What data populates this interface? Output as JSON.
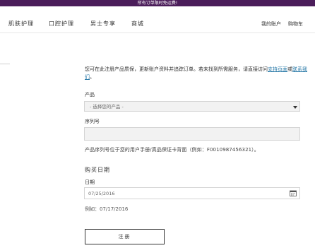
{
  "promo_banner": {
    "text": "所有订单限时免运费!"
  },
  "nav": {
    "items": [
      "肌肤护理",
      "口腔护理",
      "男士专享",
      "商城"
    ],
    "my_account": "我的账户",
    "cart": "购物车"
  },
  "intro": {
    "text_before": "您可在此注册产品质保，更新账户资料并追踪订单。若未找到所需服务，请直接访问",
    "link_support": "支持页面",
    "text_middle": "或",
    "link_contact": "联系我们",
    "text_after": "。"
  },
  "form": {
    "product_label": "产品",
    "product_select_value": "- 选择您的产品 -",
    "serial_label": "序列号",
    "serial_value": "",
    "serial_hint": "产品序列号位于您的用户手册/真品保证卡背面（例如：F0010987456321）。",
    "purchase_section_title": "购买日期",
    "date_label": "日期",
    "date_value": "07/25/2016",
    "date_example": "例如：07/17/2016",
    "submit_label": "注册"
  },
  "colors": {
    "banner": "#4b1d5a",
    "link": "#2a7aa8",
    "field_bg": "#f2f2f2"
  },
  "icons": {
    "date_picker": "calendar-icon",
    "select_caret": "caret-down-icon"
  }
}
